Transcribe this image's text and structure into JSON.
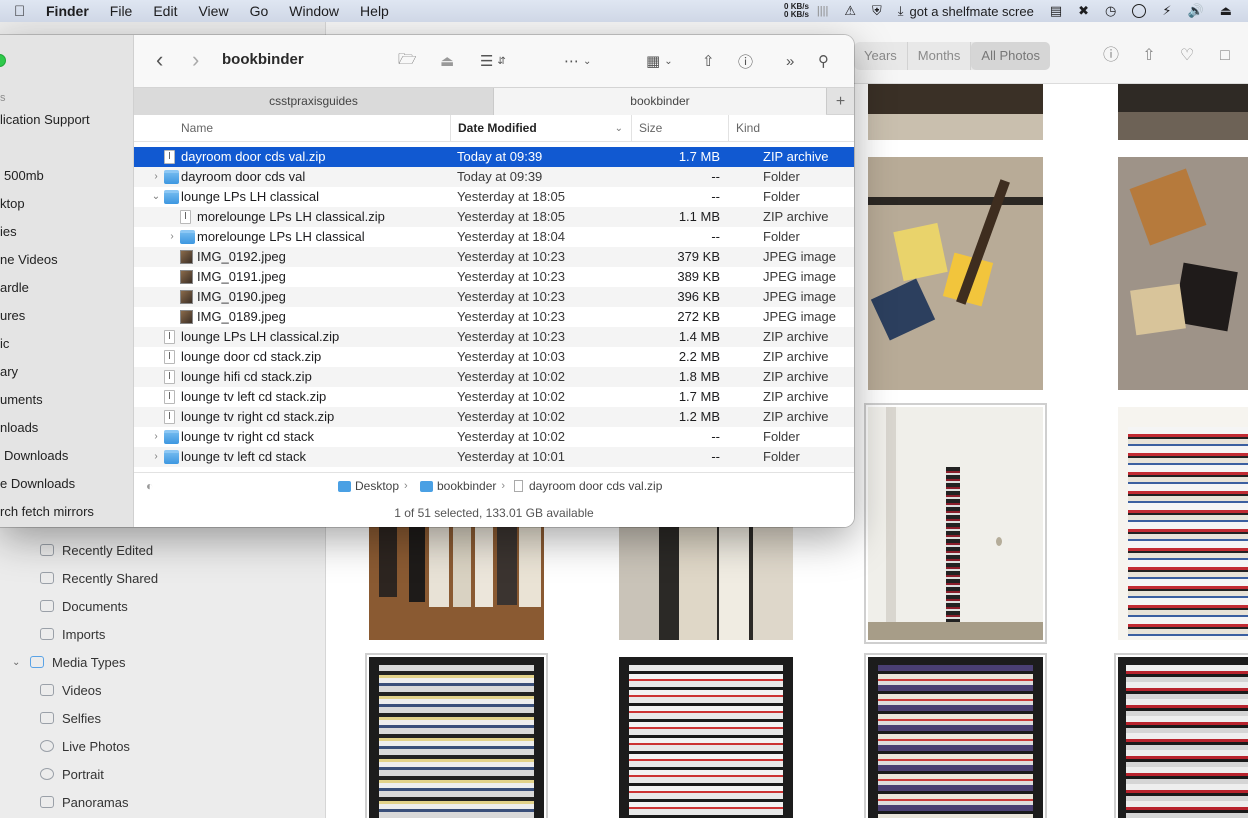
{
  "menubar": {
    "app": "Finder",
    "items": [
      "File",
      "Edit",
      "View",
      "Go",
      "Window",
      "Help"
    ],
    "net_up": "0 KB/s",
    "net_down": "0 KB/s",
    "status_text": "got a shelfmate scree"
  },
  "photos": {
    "segments": [
      "Years",
      "Months",
      "All Photos"
    ],
    "sidebar": [
      {
        "label": "Recently Edited"
      },
      {
        "label": "Recently Shared"
      },
      {
        "label": "Documents"
      },
      {
        "label": "Imports"
      },
      {
        "label": "Media Types",
        "expanded": true
      },
      {
        "label": "Videos"
      },
      {
        "label": "Selfies"
      },
      {
        "label": "Live Photos"
      },
      {
        "label": "Portrait"
      },
      {
        "label": "Panoramas"
      }
    ]
  },
  "finder": {
    "title": "bookbinder",
    "sidebar": [
      "s",
      "lication Support",
      "500mb",
      "ktop",
      "ies",
      "ne Videos",
      "ardle",
      "ures",
      "ic",
      "ary",
      "uments",
      "nloads",
      "Downloads",
      "e Downloads",
      "rch fetch mirrors"
    ],
    "tabs": [
      "csstpraxisguides",
      "bookbinder"
    ],
    "columns": {
      "name": "Name",
      "date": "Date Modified",
      "size": "Size",
      "kind": "Kind"
    },
    "rows": [
      {
        "name": "dayroom door cds val.zip",
        "date": "Today at 09:39",
        "size": "1.7 MB",
        "kind": "ZIP archive",
        "type": "zip",
        "indent": 0,
        "disclosure": "",
        "selected": true
      },
      {
        "name": "dayroom door cds val",
        "date": "Today at 09:39",
        "size": "--",
        "kind": "Folder",
        "type": "folder",
        "indent": 0,
        "disclosure": "closed"
      },
      {
        "name": "lounge LPs LH classical",
        "date": "Yesterday at 18:05",
        "size": "--",
        "kind": "Folder",
        "type": "folder",
        "indent": 0,
        "disclosure": "open"
      },
      {
        "name": "morelounge LPs LH classical.zip",
        "date": "Yesterday at 18:05",
        "size": "1.1 MB",
        "kind": "ZIP archive",
        "type": "zip",
        "indent": 1,
        "disclosure": ""
      },
      {
        "name": "morelounge LPs LH classical",
        "date": "Yesterday at 18:04",
        "size": "--",
        "kind": "Folder",
        "type": "folder",
        "indent": 1,
        "disclosure": "closed"
      },
      {
        "name": "IMG_0192.jpeg",
        "date": "Yesterday at 10:23",
        "size": "379 KB",
        "kind": "JPEG image",
        "type": "jpeg",
        "indent": 1,
        "disclosure": ""
      },
      {
        "name": "IMG_0191.jpeg",
        "date": "Yesterday at 10:23",
        "size": "389 KB",
        "kind": "JPEG image",
        "type": "jpeg",
        "indent": 1,
        "disclosure": ""
      },
      {
        "name": "IMG_0190.jpeg",
        "date": "Yesterday at 10:23",
        "size": "396 KB",
        "kind": "JPEG image",
        "type": "jpeg",
        "indent": 1,
        "disclosure": ""
      },
      {
        "name": "IMG_0189.jpeg",
        "date": "Yesterday at 10:23",
        "size": "272 KB",
        "kind": "JPEG image",
        "type": "jpeg",
        "indent": 1,
        "disclosure": ""
      },
      {
        "name": "lounge LPs LH classical.zip",
        "date": "Yesterday at 10:23",
        "size": "1.4 MB",
        "kind": "ZIP archive",
        "type": "zip",
        "indent": 0,
        "disclosure": ""
      },
      {
        "name": "lounge door cd stack.zip",
        "date": "Yesterday at 10:03",
        "size": "2.2 MB",
        "kind": "ZIP archive",
        "type": "zip",
        "indent": 0,
        "disclosure": ""
      },
      {
        "name": "lounge hifi cd stack.zip",
        "date": "Yesterday at 10:02",
        "size": "1.8 MB",
        "kind": "ZIP archive",
        "type": "zip",
        "indent": 0,
        "disclosure": ""
      },
      {
        "name": "lounge tv left cd stack.zip",
        "date": "Yesterday at 10:02",
        "size": "1.7 MB",
        "kind": "ZIP archive",
        "type": "zip",
        "indent": 0,
        "disclosure": ""
      },
      {
        "name": "lounge tv right cd stack.zip",
        "date": "Yesterday at 10:02",
        "size": "1.2 MB",
        "kind": "ZIP archive",
        "type": "zip",
        "indent": 0,
        "disclosure": ""
      },
      {
        "name": "lounge tv right cd stack",
        "date": "Yesterday at 10:02",
        "size": "--",
        "kind": "Folder",
        "type": "folder",
        "indent": 0,
        "disclosure": "closed"
      },
      {
        "name": "lounge tv left cd stack",
        "date": "Yesterday at 10:01",
        "size": "--",
        "kind": "Folder",
        "type": "folder",
        "indent": 0,
        "disclosure": "closed"
      }
    ],
    "path": [
      "Desktop",
      "bookbinder",
      "dayroom door cds val.zip"
    ],
    "status": "1 of 51 selected, 133.01 GB available"
  },
  "colors": {
    "selection": "#1159d1",
    "folder": "#4aa0e4"
  }
}
